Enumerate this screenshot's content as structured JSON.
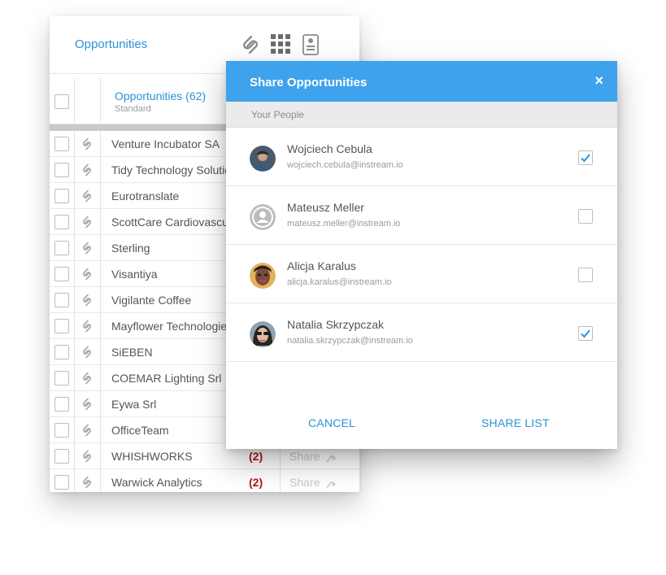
{
  "panel": {
    "title": "Opportunities",
    "header_icons": [
      "link-icon",
      "grid-icon",
      "contact-card-icon"
    ],
    "list_title": "Opportunities (62)",
    "list_subtitle": "Standard",
    "rows": [
      {
        "name": "Venture Incubator SA",
        "count": "",
        "share": ""
      },
      {
        "name": "Tidy Technology Solutio",
        "count": "",
        "share": ""
      },
      {
        "name": "Eurotranslate",
        "count": "",
        "share": ""
      },
      {
        "name": "ScottCare Cardiovascu",
        "count": "",
        "share": ""
      },
      {
        "name": "Sterling",
        "count": "",
        "share": ""
      },
      {
        "name": "Visantiya",
        "count": "",
        "share": ""
      },
      {
        "name": "Vigilante Coffee",
        "count": "",
        "share": ""
      },
      {
        "name": "Mayflower Technologie",
        "count": "",
        "share": ""
      },
      {
        "name": "SiEBEN",
        "count": "",
        "share": ""
      },
      {
        "name": "COEMAR Lighting Srl",
        "count": "",
        "share": ""
      },
      {
        "name": "Eywa Srl",
        "count": "",
        "share": ""
      },
      {
        "name": "OfficeTeam",
        "count": "",
        "share": ""
      },
      {
        "name": "WHISHWORKS",
        "count": "(2)",
        "share": "Share"
      },
      {
        "name": "Warwick Analytics",
        "count": "(2)",
        "share": "Share"
      }
    ]
  },
  "modal": {
    "title": "Share Opportunities",
    "close": "×",
    "section": "Your People",
    "people": [
      {
        "name": "Wojciech Cebula",
        "email": "wojciech.cebula@instream.io",
        "checked": true,
        "avatar": "photo"
      },
      {
        "name": "Mateusz Meller",
        "email": "mateusz.meller@instream.io",
        "checked": false,
        "avatar": "placeholder"
      },
      {
        "name": "Alicja Karalus",
        "email": "alicja.karalus@instream.io",
        "checked": false,
        "avatar": "photo"
      },
      {
        "name": "Natalia Skrzypczak",
        "email": "natalia.skrzypczak@instream.io",
        "checked": true,
        "avatar": "photo"
      }
    ],
    "cancel_label": "CANCEL",
    "share_label": "SHARE LIST"
  },
  "colors": {
    "accent": "#3ea2ec",
    "link": "#2a93d5",
    "count": "#b3131c"
  }
}
